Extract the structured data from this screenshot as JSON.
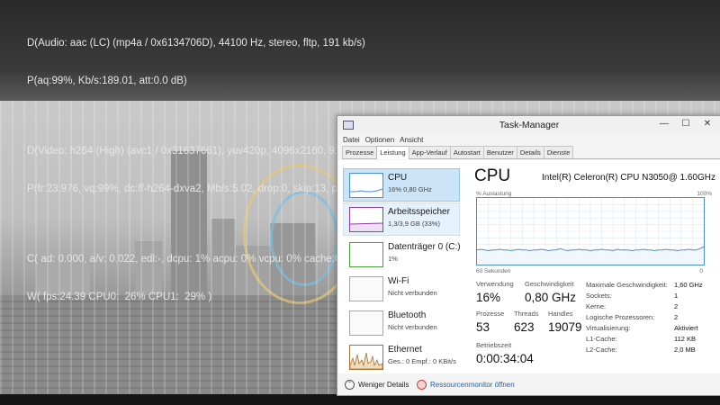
{
  "osd": {
    "audio": "D(Audio: aac (LC) (mp4a / 0x6134706D), 44100 Hz, stereo, fltp, 191 kb/s)",
    "audio_params": "P(aq:99%, Kb/s:189.01, att:0.0 dB)",
    "video": "D(Video: h264 (High) (avc1 / 0x31637661), yuv420p, 4096x2160, 9165 kb/s)",
    "video_params": "P(fr:23.976, vq:99%, dc:ff-h264-dxva2, Mb/s:5.02, drop:0, skip:13, pc:1)",
    "clock": "C( ad: 0.000, a/v: 0.022, edl:-, dcpu: 1% acpu: 0% vcpu: 0% cache:0 B 99% )",
    "fps": "W( fps:24.39 CPU0:  26% CPU1:  29% )"
  },
  "window": {
    "title": "Task-Manager",
    "minimize": "—",
    "maximize": "☐",
    "close": "✕"
  },
  "menu": [
    "Datei",
    "Optionen",
    "Ansicht"
  ],
  "tabs": [
    "Prozesse",
    "Leistung",
    "App-Verlauf",
    "Autostart",
    "Benutzer",
    "Details",
    "Dienste"
  ],
  "active_tab": "Leistung",
  "sidebar": [
    {
      "name": "CPU",
      "sub": "16% 0,80 GHz",
      "icon": "cpu-graph-icon",
      "color": "#4a8ed0"
    },
    {
      "name": "Arbeitsspeicher",
      "sub": "1,3/3,9 GB (33%)",
      "icon": "memory-graph-icon",
      "color": "#8d3ea0"
    },
    {
      "name": "Datenträger 0 (C:)",
      "sub": "1%",
      "icon": "disk-graph-icon",
      "color": "#4c9e3c"
    },
    {
      "name": "Wi-Fi",
      "sub": "Nicht verbunden",
      "icon": "wifi-graph-icon",
      "color": "#a8a8a8"
    },
    {
      "name": "Bluetooth",
      "sub": "Nicht verbunden",
      "icon": "bluetooth-graph-icon",
      "color": "#a8a8a8"
    },
    {
      "name": "Ethernet",
      "sub": "Ges.: 0  Empf.: 0 KBit/s",
      "icon": "ethernet-graph-icon",
      "color": "#a67233"
    }
  ],
  "detail": {
    "title": "CPU",
    "model": "Intel(R) Celeron(R) CPU N3050@ 1.60GHz",
    "usage_label": "% Auslastung",
    "max_label": "100%",
    "time_label": "60 Sekunden",
    "zero_label": "0",
    "stats": {
      "usage_label": "Verwendung",
      "usage": "16%",
      "speed_label": "Geschwindigkeit",
      "speed": "0,80 GHz",
      "proc_label": "Prozesse",
      "proc": "53",
      "threads_label": "Threads",
      "threads": "623",
      "handles_label": "Handles",
      "handles": "19079",
      "uptime_label": "Betriebszeit",
      "uptime": "0:00:34:04"
    },
    "specs": [
      {
        "label": "Maximale Geschwindigkeit:",
        "value": "1,60 GHz"
      },
      {
        "label": "Sockets:",
        "value": "1"
      },
      {
        "label": "Kerne:",
        "value": "2"
      },
      {
        "label": "Logische Prozessoren:",
        "value": "2"
      },
      {
        "label": "Virtualisierung:",
        "value": "Aktiviert"
      },
      {
        "label": "L1-Cache:",
        "value": "112 KB"
      },
      {
        "label": "L2-Cache:",
        "value": "2,0 MB"
      }
    ]
  },
  "cpu_history": [
    22,
    23,
    22,
    21,
    22,
    22,
    23,
    22,
    22,
    21,
    22,
    23,
    22,
    22,
    21,
    22,
    22,
    23,
    22,
    21,
    22,
    22,
    24,
    22,
    21,
    22,
    22,
    23,
    22,
    22,
    21,
    22,
    22,
    23,
    22,
    22,
    21,
    23,
    22,
    22,
    22,
    21,
    22,
    22,
    23,
    22,
    22,
    21,
    22,
    22,
    23,
    22,
    22,
    21,
    22,
    22,
    23,
    22,
    22,
    24,
    27
  ],
  "footer": {
    "less_details": "Weniger Details",
    "resource_monitor": "Ressourcenmonitor öffnen"
  }
}
